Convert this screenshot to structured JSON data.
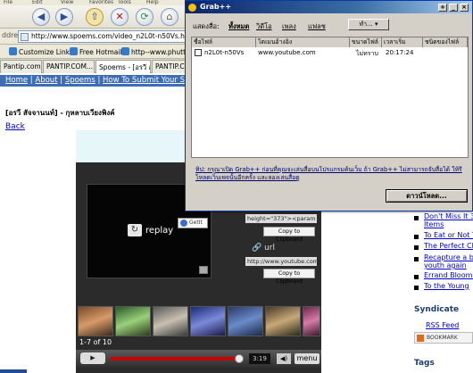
{
  "browser": {
    "menu_items": [
      "File",
      "Edit",
      "View",
      "Favorites",
      "Tools",
      "Help"
    ],
    "address_label": "ddress",
    "address_value": "http://www.spoems.com/video_n2L0t-n50Vs.html",
    "links_bar": [
      "Customize Links",
      "Free Hotmail",
      "http--www.phutta.com"
    ],
    "tabs": [
      "Pantip.com : 3...",
      "PANTIP.COM...",
      "Spoems - [อรวี สัจจา...",
      "PANTIP.CO..."
    ]
  },
  "page": {
    "nav": [
      "Home",
      "About",
      "Spoems",
      "How To Submit Your Spoems"
    ],
    "heading": "[อรวี สัจจานนท์] - กุหลาบเวียงพิงค์",
    "back_link": "Back",
    "player": {
      "replay_label": "replay",
      "getit_label": "GetIt",
      "embed_code": "height=\"373\"><param",
      "copy_label_1": "Copy to Clipboard",
      "url_label": "url",
      "url_value": "http://www.youtube.com/",
      "copy_label_2": "Copy to Clipboard",
      "thumb_count": "1-7 of 10",
      "time": "3:19",
      "menu_label": "menu"
    },
    "sidebar": {
      "related": [
        "Don't Miss It 3",
        "Items",
        "To Eat or Not T",
        "The Perfect Ch",
        "Recapture a bi",
        "youth again",
        "Errand Bloomin",
        "To the Young"
      ],
      "syndicate_heading": "Syndicate",
      "rss_link": "RSS Feed",
      "bookmark_label": "BOOKMARK",
      "tags_heading": "Tags"
    }
  },
  "grab": {
    "title": "Grab++",
    "show_label": "แสดงสื่อ:",
    "filters": [
      "ทั้งหมด",
      "วิดีโอ",
      "เพลง",
      "แฟลช"
    ],
    "more_button": "ทำ...",
    "columns": [
      "ชื่อไฟล์",
      "โดเมนอ้างอิง",
      "ขนาดไฟล์",
      "เวลาเริ่ม",
      "ชนิดของไฟล์"
    ],
    "rows": [
      {
        "filename": "n2L0t-n50Vs",
        "domain": "www.youtube.com",
        "size": "ไม่ทราบ",
        "time": "20:17:24",
        "type": ""
      }
    ],
    "note": "ทิป: กรุณาเปิด Grab++ ก่อนที่คุณจะเล่นสื่อบนโปรแกรมค้นเว็บ ถ้า Grab++ ไม่สามารถจับสื่อได้ ให้รีโหลดเว็บเพจนั้นอีกครั้ง และลองเล่นสื่อดู",
    "download_button": "ดาวน์โหลด..."
  },
  "colors": {
    "titlebar": "#0a246a",
    "site_nav": "#3d6db5",
    "seek_bar": "#cc0000",
    "link": "#0000cc"
  }
}
